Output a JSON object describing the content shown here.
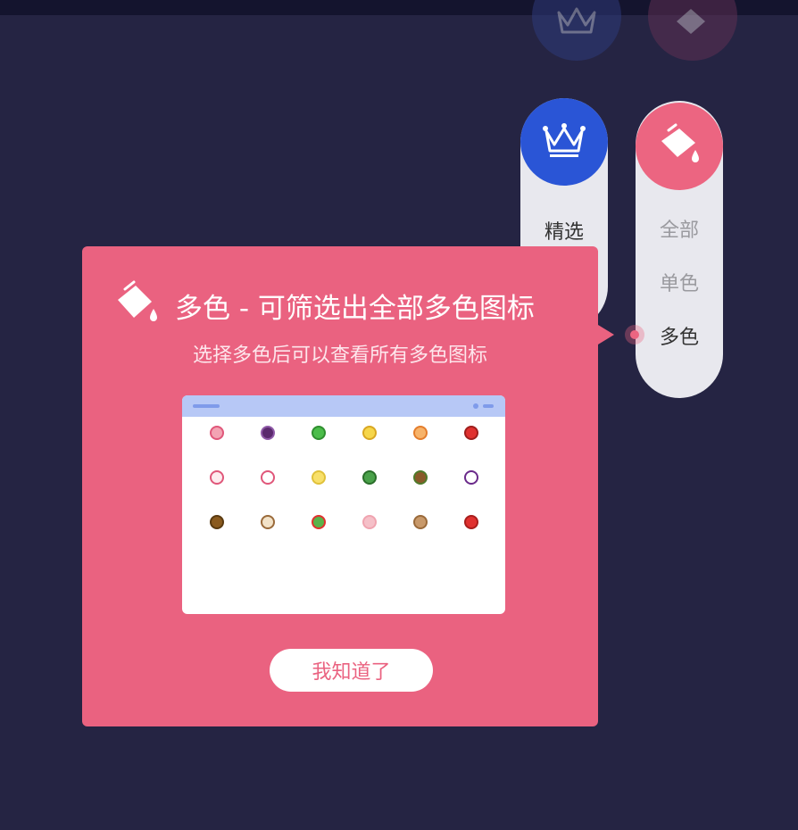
{
  "toolbar": {
    "featured": {
      "label": "精选",
      "icon": "crown-icon",
      "color": "#2a55d6"
    },
    "color_filter": {
      "icon": "paint-bucket-icon",
      "color": "#ec6581",
      "options": [
        {
          "label": "全部",
          "selected": false
        },
        {
          "label": "单色",
          "selected": false
        },
        {
          "label": "多色",
          "selected": true
        }
      ]
    }
  },
  "tooltip": {
    "icon": "paint-bucket-icon",
    "title": "多色 - 可筛选出全部多色图标",
    "subtitle": "选择多色后可以查看所有多色图标",
    "confirm_label": "我知道了",
    "background": "#ea6280"
  },
  "preview": {
    "icons": [
      {
        "color": "#f3a3b3",
        "ring": "#e0577a"
      },
      {
        "color": "#5b2a6e",
        "ring": "#8f5aa8"
      },
      {
        "color": "#4bbd4a",
        "ring": "#2f8f2f"
      },
      {
        "color": "#f6d64a",
        "ring": "#d9a722"
      },
      {
        "color": "#f7b36a",
        "ring": "#e47d2c"
      },
      {
        "color": "#e0312f",
        "ring": "#9e1e1c"
      },
      {
        "color": "#fdecef",
        "ring": "#e0577a"
      },
      {
        "color": "#ffffff",
        "ring": "#e0577a"
      },
      {
        "color": "#f8e06a",
        "ring": "#e0c13a"
      },
      {
        "color": "#4aa14a",
        "ring": "#2a6e2a"
      },
      {
        "color": "#8a5a2a",
        "ring": "#4f7a2a"
      },
      {
        "color": "#ffffff",
        "ring": "#6a2a8a"
      },
      {
        "color": "#8a5a1e",
        "ring": "#5a3a10"
      },
      {
        "color": "#f2e2c8",
        "ring": "#9a6a3a"
      },
      {
        "color": "#5ab24a",
        "ring": "#e0312f"
      },
      {
        "color": "#f5c0c8",
        "ring": "#f0a4b0"
      },
      {
        "color": "#c8996a",
        "ring": "#9a6a3a"
      },
      {
        "color": "#e0312f",
        "ring": "#a81e1c"
      }
    ]
  }
}
